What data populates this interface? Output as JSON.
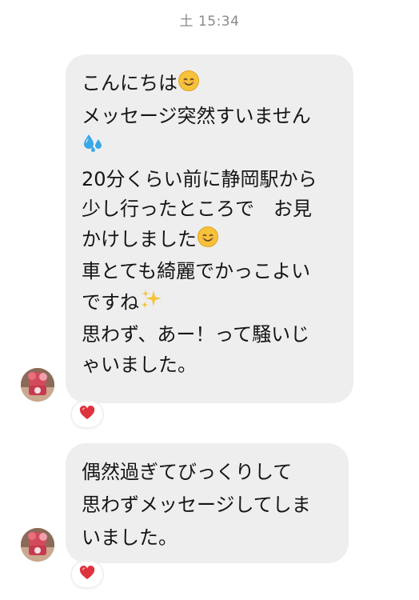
{
  "timestamp": "土 15:34",
  "messages": [
    {
      "lines": [
        [
          "こんにちは",
          "smile-emoji"
        ],
        [
          "メッセージ突然すいません",
          null
        ],
        [
          "",
          "sweat-drops-emoji"
        ],
        [
          "20分くらい前に静岡駅から",
          null
        ],
        [
          "少し行ったところで　お見",
          null
        ],
        [
          "かけしました",
          "smile-emoji"
        ],
        [
          "車とても綺麗でかっこよい",
          null
        ],
        [
          "ですね",
          "sparkles-emoji"
        ],
        [
          "思わず、あー！って騒いじ",
          null
        ],
        [
          "ゃいました。",
          null
        ]
      ],
      "reaction": "heart-emoji"
    },
    {
      "lines": [
        [
          "偶然過ぎてびっくりして",
          null
        ],
        [
          "思わずメッセージしてしま",
          null
        ],
        [
          "いました。",
          null
        ]
      ],
      "reaction": "heart-emoji"
    }
  ],
  "m1": {
    "l0": "こんにちは",
    "l1": "メッセージ突然すいません",
    "l3": "20分くらい前に静岡駅から",
    "l4": "少し行ったところで　お見",
    "l5": "かけしました",
    "l6": "車とても綺麗でかっこよい",
    "l7": "ですね",
    "l8": "思わず、あー！って騒いじ",
    "l9": "ゃいました。"
  },
  "m2": {
    "l0": "偶然過ぎてびっくりして",
    "l1": "思わずメッセージしてしま",
    "l2": "いました。"
  },
  "colors": {
    "bubble": "#eeeeef",
    "timestamp": "#8a8a8a",
    "heart": "#e0323c",
    "smile": "#f7c23a",
    "drops": "#3aa8e6",
    "sparkles": "#f5c43b"
  }
}
